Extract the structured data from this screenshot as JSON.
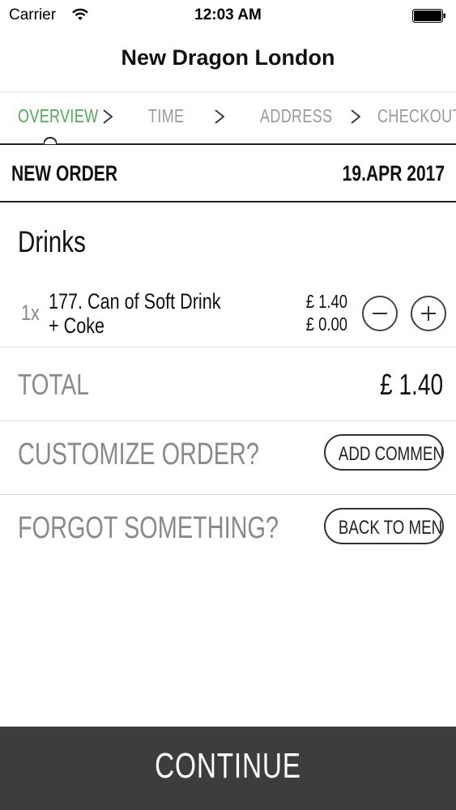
{
  "status_bar": {
    "carrier": "Carrier",
    "time": "12:03 AM"
  },
  "nav": {
    "title": "New Dragon London"
  },
  "steps": [
    {
      "label": "OVERVIEW",
      "active": true
    },
    {
      "label": "TIME",
      "active": false
    },
    {
      "label": "ADDRESS",
      "active": false
    },
    {
      "label": "CHECKOUT",
      "active": false
    }
  ],
  "order": {
    "label": "NEW ORDER",
    "date": "19.APR 2017"
  },
  "category": "Drinks",
  "items": [
    {
      "qty": "1x",
      "name_line1": "177. Can of Soft Drink",
      "name_line2": "+ Coke",
      "price": "£ 1.40",
      "extra_price": "£ 0.00"
    }
  ],
  "total": {
    "label": "TOTAL",
    "value": "£ 1.40"
  },
  "customize": {
    "label": "CUSTOMIZE ORDER?",
    "button": "ADD COMMENT"
  },
  "forgot": {
    "label": "FORGOT SOMETHING?",
    "button": "BACK TO MENU"
  },
  "continue_label": "CONTINUE",
  "colors": {
    "accent": "#4caf50",
    "continue_bg": "#3e3d3d"
  },
  "icons": {
    "wifi": "wifi-icon",
    "battery": "battery-icon",
    "chevron": "chevron-right-icon",
    "minus": "minus-circle-icon",
    "plus": "plus-circle-icon"
  }
}
